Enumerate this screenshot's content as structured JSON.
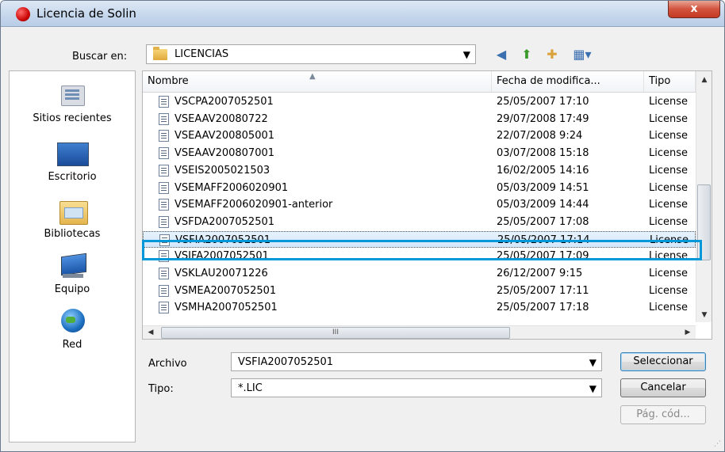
{
  "window": {
    "title": "Licencia de Solin",
    "close_glyph": "x"
  },
  "lookin": {
    "label": "Buscar en:",
    "value": "LICENCIAS",
    "folder_icon": "folder-icon"
  },
  "toolbar": {
    "back_icon": "back-icon",
    "up_icon": "up-folder-icon",
    "newfolder_icon": "new-folder-icon",
    "views_icon": "views-menu-icon"
  },
  "places": [
    {
      "label": "Sitios recientes",
      "icon": "recent-places-icon"
    },
    {
      "label": "Escritorio",
      "icon": "desktop-icon"
    },
    {
      "label": "Bibliotecas",
      "icon": "libraries-icon"
    },
    {
      "label": "Equipo",
      "icon": "computer-icon"
    },
    {
      "label": "Red",
      "icon": "network-icon"
    }
  ],
  "columns": {
    "name": "Nombre",
    "date": "Fecha de modifica...",
    "type": "Tipo"
  },
  "files": [
    {
      "name": "VSCPA2007052501",
      "date": "25/05/2007 17:10",
      "type": "License"
    },
    {
      "name": "VSEAAV20080722",
      "date": "29/07/2008 17:49",
      "type": "License"
    },
    {
      "name": "VSEAAV200805001",
      "date": "22/07/2008 9:24",
      "type": "License"
    },
    {
      "name": "VSEAAV200807001",
      "date": "03/07/2008 15:18",
      "type": "License"
    },
    {
      "name": "VSEIS2005021503",
      "date": "16/02/2005 14:16",
      "type": "License"
    },
    {
      "name": "VSEMAFF2006020901",
      "date": "05/03/2009 14:51",
      "type": "License"
    },
    {
      "name": "VSEMAFF2006020901-anterior",
      "date": "05/03/2009 14:44",
      "type": "License"
    },
    {
      "name": "VSFDA2007052501",
      "date": "25/05/2007 17:08",
      "type": "License"
    },
    {
      "name": "VSFIA2007052501",
      "date": "25/05/2007 17:14",
      "type": "License",
      "selected": true
    },
    {
      "name": "VSIFA2007052501",
      "date": "25/05/2007 17:09",
      "type": "License"
    },
    {
      "name": "VSKLAU20071226",
      "date": "26/12/2007 9:15",
      "type": "License"
    },
    {
      "name": "VSMEA2007052501",
      "date": "25/05/2007 17:11",
      "type": "License"
    },
    {
      "name": "VSMHA2007052501",
      "date": "25/05/2007 17:18",
      "type": "License"
    }
  ],
  "scroll": {
    "hthumb_grip": "III"
  },
  "filename": {
    "label": "Archivo",
    "value": "VSFIA2007052501"
  },
  "filetype": {
    "label": "Tipo:",
    "value": "*.LIC"
  },
  "buttons": {
    "select": "Seleccionar",
    "cancel": "Cancelar",
    "codepage": "Pág. cód..."
  },
  "colors": {
    "highlight": "#0098d9",
    "titlebar": "#c4d6ec",
    "close": "#d3533d"
  }
}
